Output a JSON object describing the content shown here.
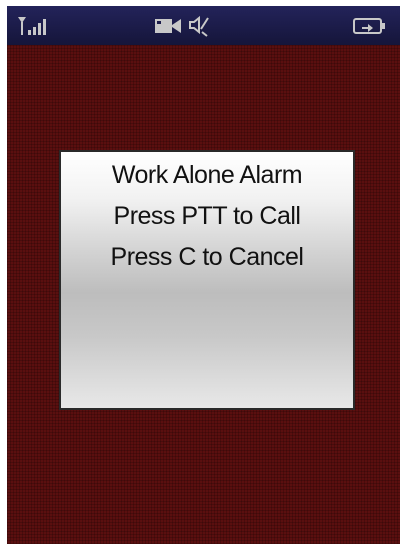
{
  "status_bar": {
    "icons": [
      "signal-antenna-icon",
      "video-camera-icon",
      "speaker-mute-icon",
      "battery-icon"
    ],
    "colors": {
      "background": "#1c1c4a",
      "icon": "#c8c8c8"
    }
  },
  "dialog": {
    "line1": "Work Alone Alarm",
    "line2": "Press PTT to Call",
    "line3": "Press C to Cancel"
  },
  "colors": {
    "screen_background": "#5a0f0f",
    "dialog_border": "#2a2a2a",
    "dialog_text": "#111111"
  }
}
